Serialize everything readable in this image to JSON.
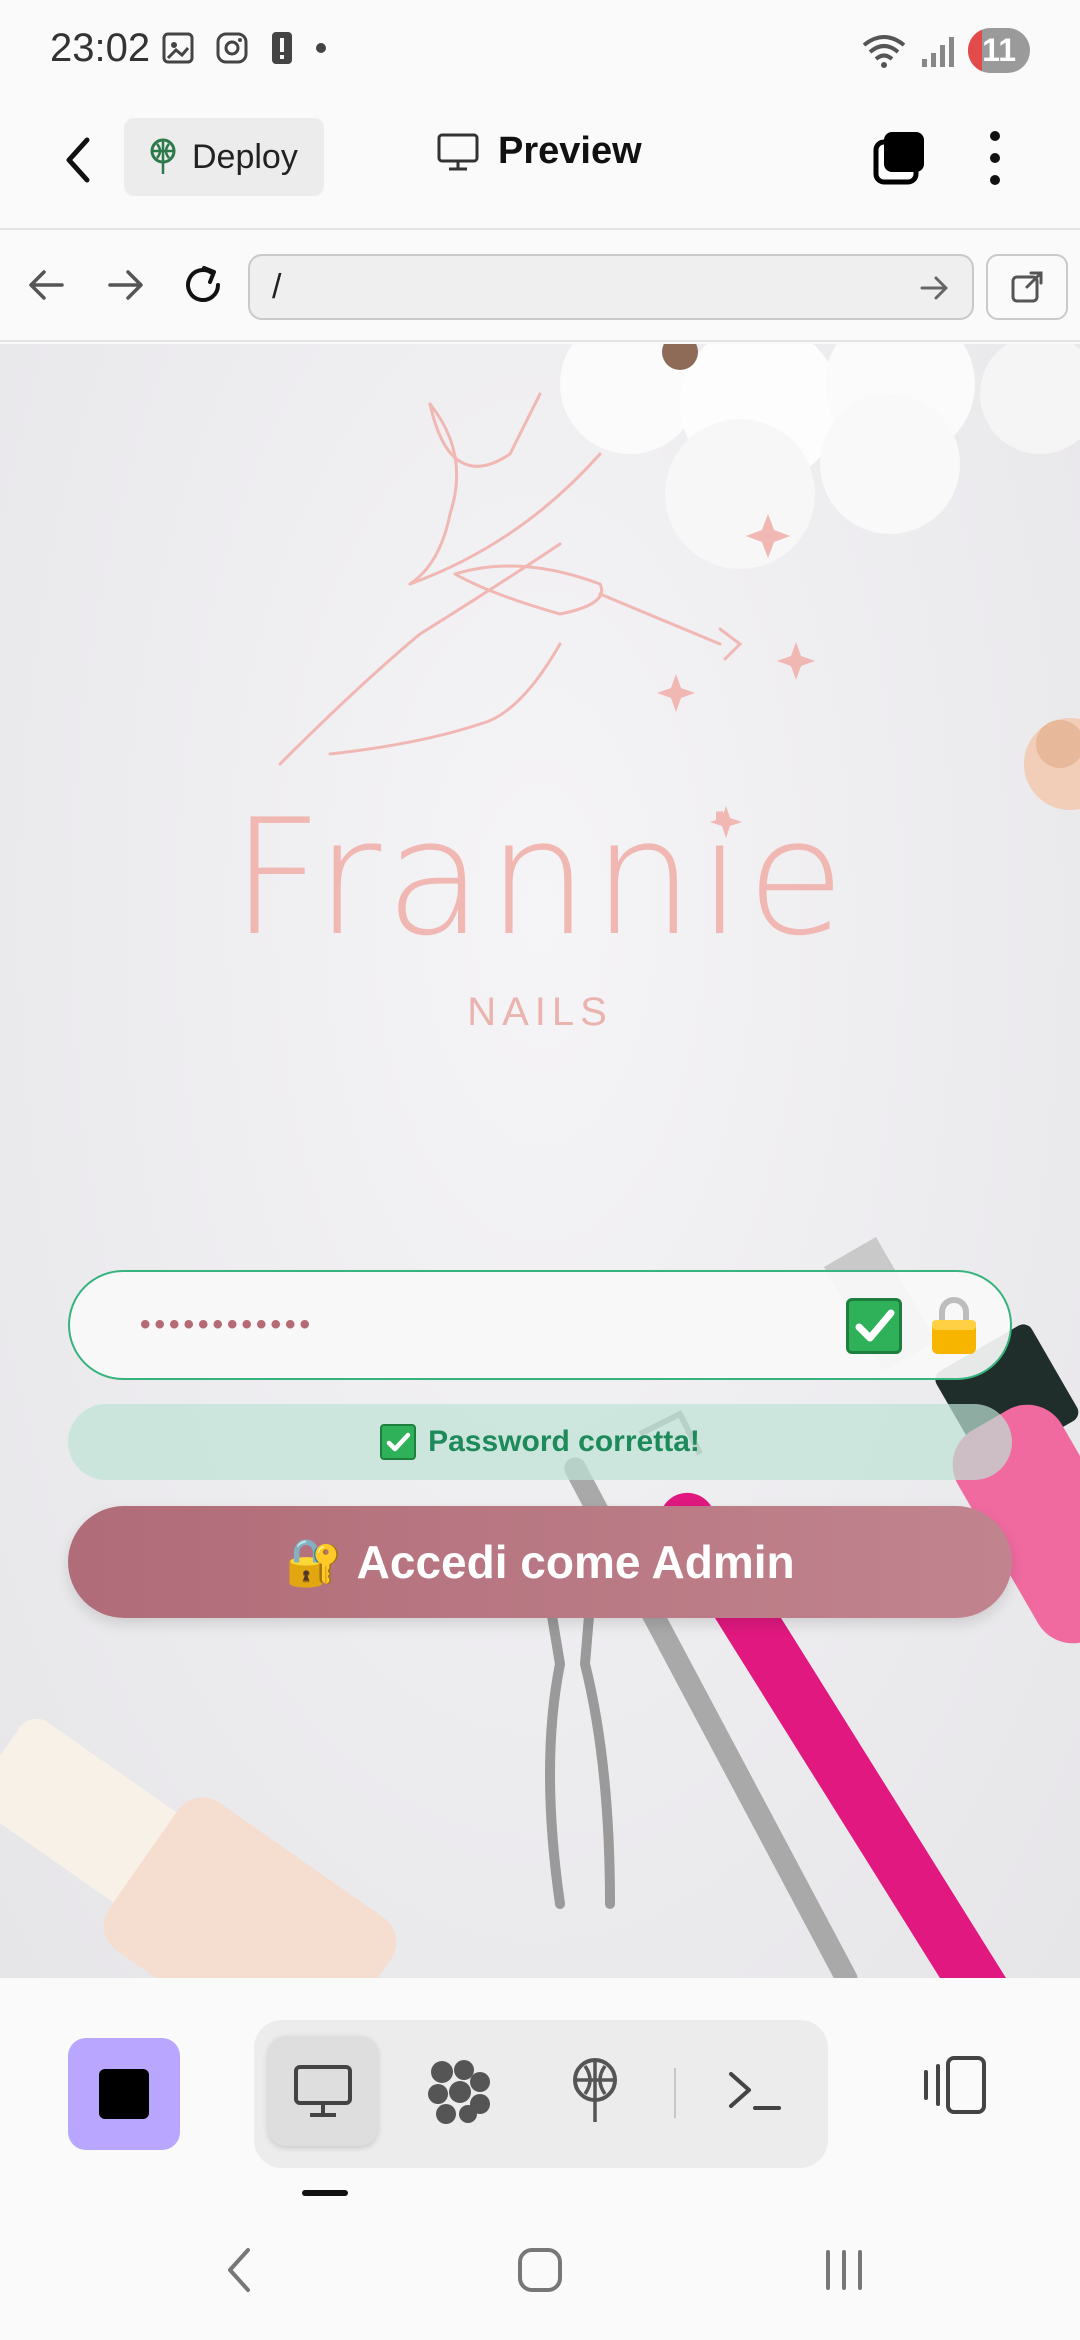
{
  "status_bar": {
    "time": "23:02",
    "battery": "11"
  },
  "header": {
    "deploy_label": "Deploy",
    "title": "Preview"
  },
  "browser": {
    "url": "/"
  },
  "brand": {
    "name": "Frannie",
    "tagline": "NAILS"
  },
  "login": {
    "password_masked": "••••••••••••",
    "status_message": "Password corretta!",
    "submit_label": "Accedi come Admin",
    "submit_emoji": "🔐"
  },
  "colors": {
    "accent_purple": "#b9a6ff",
    "success_green": "#36b37e",
    "button_rose": "#b06c78",
    "brand_pink": "#f0b7b3"
  },
  "toolbar": {
    "tools": [
      "monitor-icon",
      "cluster-icon",
      "deploy-icon",
      "terminal-icon"
    ],
    "active_tool": "monitor-icon"
  }
}
